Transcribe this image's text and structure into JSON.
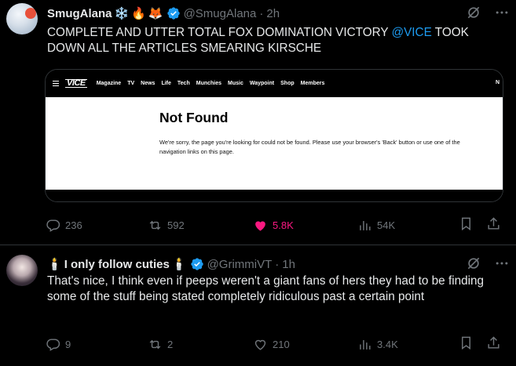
{
  "tweets": [
    {
      "display_name": "SmugAlana",
      "name_emojis": [
        "❄️",
        "🔥",
        "🦊"
      ],
      "handle": "@SmugAlana",
      "separator": "·",
      "time": "2h",
      "text_before": "COMPLETE AND UTTER TOTAL FOX DOMINATION VICTORY ",
      "mention": "@VICE",
      "text_after": " TOOK DOWN ALL THE ARTICLES SMEARING KIRSCHE",
      "media": {
        "nav_logo": "VICE",
        "nav_items": [
          "Magazine",
          "TV",
          "News",
          "Life",
          "Tech",
          "Munchies",
          "Music",
          "Waypoint",
          "Shop",
          "Members"
        ],
        "nav_right": "N",
        "page_title": "Not Found",
        "page_body": "We're sorry, the page you're looking for could not be found. Please use your browser's 'Back' button or use one of the navigation links on this page."
      },
      "replies": "236",
      "reposts": "592",
      "likes": "5.8K",
      "liked": true,
      "views": "54K"
    },
    {
      "display_name": "I only follow cuties",
      "name_emojis": [
        "🕯️",
        "🕯️"
      ],
      "handle": "@GrimmiVT",
      "separator": "·",
      "time": "1h",
      "text": "That's nice, I think even if peeps weren't a giant fans of hers they had to be finding some of the stuff being stated completely ridiculous past a certain point",
      "replies": "9",
      "reposts": "2",
      "likes": "210",
      "liked": false,
      "views": "3.4K"
    }
  ],
  "colors": {
    "background": "#000000",
    "text": "#e7e9ea",
    "muted": "#71767b",
    "accent": "#1d9bf0",
    "like": "#f91880",
    "border": "#2f3336"
  }
}
